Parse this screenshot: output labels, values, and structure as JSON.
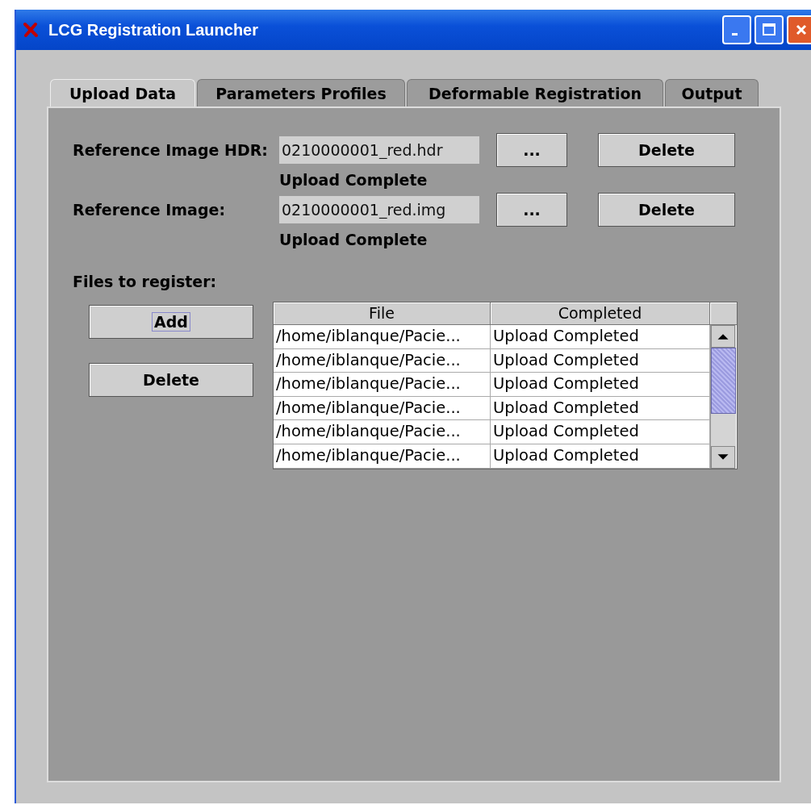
{
  "window": {
    "title": "LCG Registration Launcher"
  },
  "tabs": [
    {
      "label": "Upload Data",
      "selected": true
    },
    {
      "label": "Parameters Profiles",
      "selected": false
    },
    {
      "label": "Deformable Registration",
      "selected": false
    },
    {
      "label": "Output",
      "selected": false
    }
  ],
  "reference_fields": [
    {
      "label": "Reference Image HDR:",
      "value": "0210000001_red.hdr",
      "browse_button": "...",
      "delete_button": "Delete",
      "status": "Upload Complete"
    },
    {
      "label": "Reference Image:",
      "value": "0210000001_red.img",
      "browse_button": "...",
      "delete_button": "Delete",
      "status": "Upload Complete"
    }
  ],
  "files": {
    "label": "Files to register:",
    "buttons": [
      {
        "label": "Add",
        "focused": true
      },
      {
        "label": "Delete",
        "focused": false
      }
    ],
    "table": {
      "columns": [
        "File",
        "Completed"
      ],
      "rows": [
        [
          "/home/iblanque/Pacie...",
          "Upload Completed"
        ],
        [
          "/home/iblanque/Pacie...",
          "Upload Completed"
        ],
        [
          "/home/iblanque/Pacie...",
          "Upload Completed"
        ],
        [
          "/home/iblanque/Pacie...",
          "Upload Completed"
        ],
        [
          "/home/iblanque/Pacie...",
          "Upload Completed"
        ],
        [
          "/home/iblanque/Pacie...",
          "Upload Completed"
        ]
      ]
    }
  }
}
